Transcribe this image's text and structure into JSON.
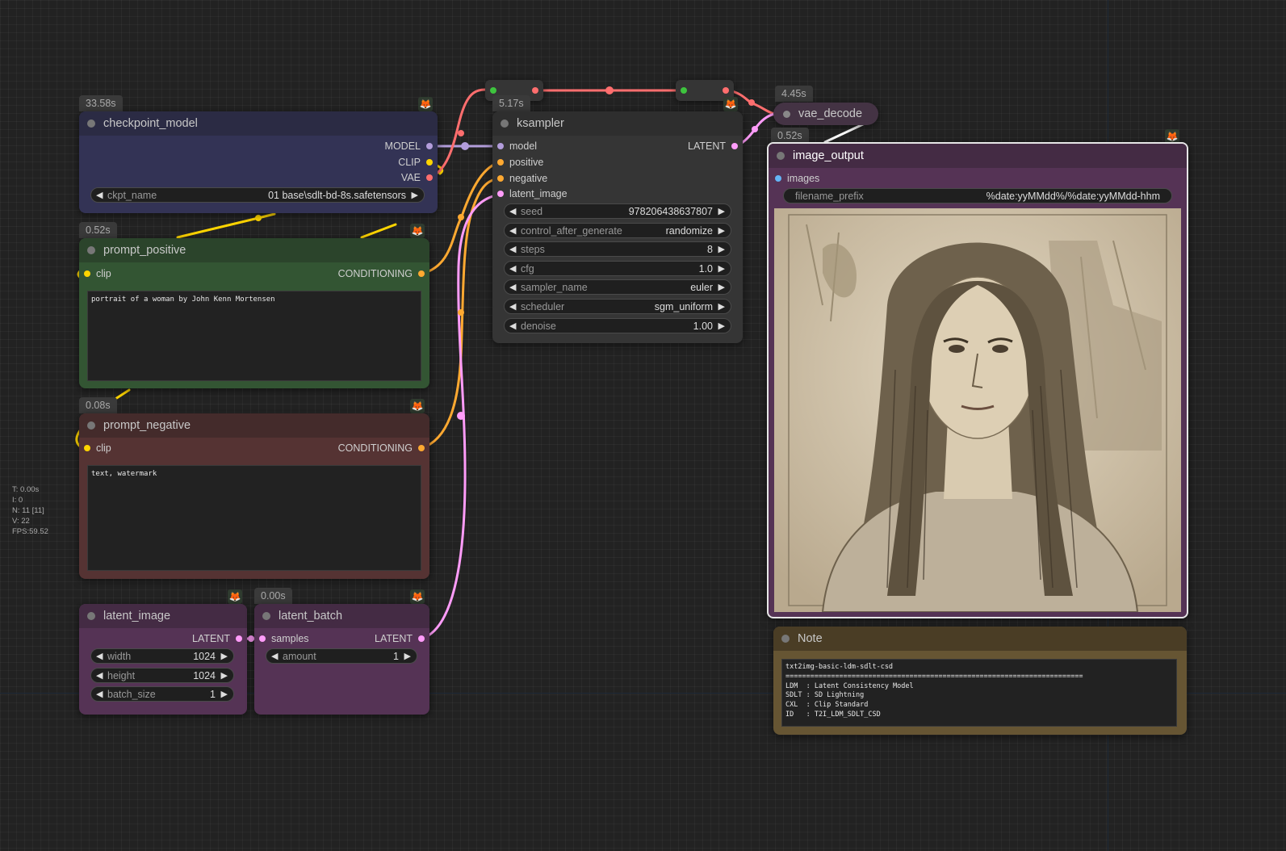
{
  "colors": {
    "model_link": "#b39ddb",
    "clip_link": "#ffd500",
    "vae_link": "#ff6e6e",
    "conditioning_link": "#ffa931",
    "latent_link": "#ff9cf9",
    "image_link": "#64b5f6"
  },
  "icons": {
    "node_badge": "fox-icon",
    "slot": "dot-icon",
    "widget_dec": "left-arrow-icon",
    "widget_inc": "right-arrow-icon"
  },
  "nodes": {
    "checkpoint": {
      "title": "checkpoint_model",
      "time": "33.58s",
      "outputs": [
        "MODEL",
        "CLIP",
        "VAE"
      ],
      "ckpt_label": "ckpt_name",
      "ckpt_value": "01 base\\sdlt-bd-8s.safetensors"
    },
    "prompt_positive": {
      "title": "prompt_positive",
      "time": "0.52s",
      "input": "clip",
      "output": "CONDITIONING",
      "text": "portrait of a woman by John Kenn Mortensen"
    },
    "prompt_negative": {
      "title": "prompt_negative",
      "time": "0.08s",
      "input": "clip",
      "output": "CONDITIONING",
      "text": "text, watermark"
    },
    "latent_image": {
      "title": "latent_image",
      "output": "LATENT",
      "width_label": "width",
      "width_value": "1024",
      "height_label": "height",
      "height_value": "1024",
      "batch_label": "batch_size",
      "batch_value": "1"
    },
    "latent_batch": {
      "title": "latent_batch",
      "time": "0.00s",
      "input": "samples",
      "output": "LATENT",
      "amount_label": "amount",
      "amount_value": "1"
    },
    "ksampler": {
      "title": "ksampler",
      "time": "5.17s",
      "inputs": [
        "model",
        "positive",
        "negative",
        "latent_image"
      ],
      "output": "LATENT",
      "widgets": [
        {
          "label": "seed",
          "value": "978206438637807"
        },
        {
          "label": "control_after_generate",
          "value": "randomize"
        },
        {
          "label": "steps",
          "value": "8"
        },
        {
          "label": "cfg",
          "value": "1.0"
        },
        {
          "label": "sampler_name",
          "value": "euler"
        },
        {
          "label": "scheduler",
          "value": "sgm_uniform"
        },
        {
          "label": "denoise",
          "value": "1.00"
        }
      ]
    },
    "vae_decode": {
      "title": "vae_decode",
      "time": "4.45s"
    },
    "image_output": {
      "title": "image_output",
      "time": "0.52s",
      "input": "images",
      "prefix_label": "filename_prefix",
      "prefix_value": "%date:yyMMdd%/%date:yyMMdd-hhm",
      "image_alt": "pencil sketch portrait"
    },
    "note": {
      "title": "Note",
      "text": "txt2img-basic-ldm-sdlt-csd\n========================================================================\nLDM  : Latent Consistency Model\nSDLT : SD Lightning\nCXL  : Clip Standard\nID   : T2I_LDM_SDLT_CSD"
    }
  },
  "stats": {
    "t": "T: 0.00s",
    "i": "I: 0",
    "n": "N: 11 [11]",
    "v": "V: 22",
    "fps": "FPS:59.52"
  }
}
